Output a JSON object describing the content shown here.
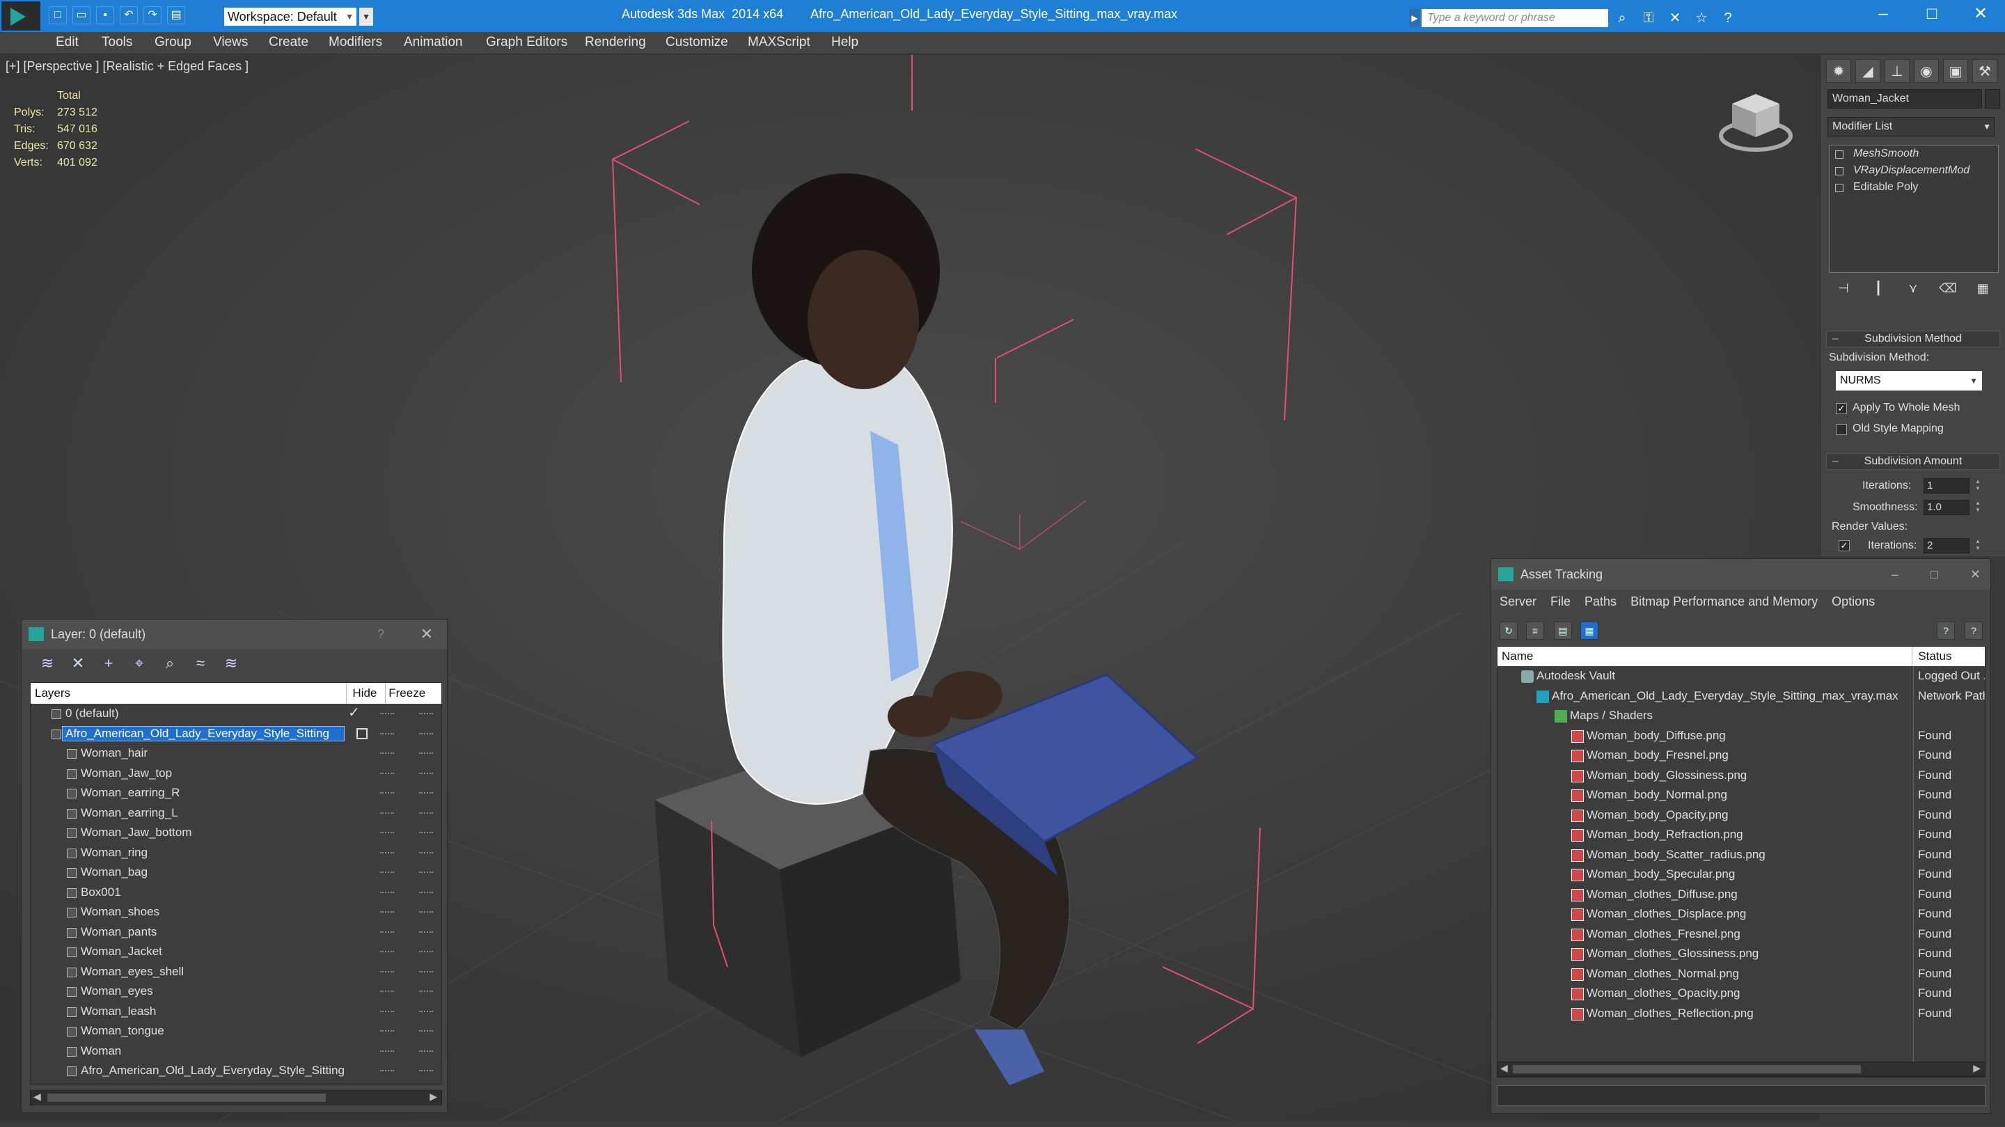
{
  "window": {
    "app_title": "Autodesk 3ds Max  2014 x64",
    "file_title": "Afro_American_Old_Lady_Everyday_Style_Sitting_max_vray.max",
    "workspace": "Workspace: Default",
    "search_placeholder": "Type a keyword or phrase"
  },
  "menu": [
    "Edit",
    "Tools",
    "Group",
    "Views",
    "Create",
    "Modifiers",
    "Animation",
    "Graph Editors",
    "Rendering",
    "Customize",
    "MAXScript",
    "Help"
  ],
  "viewport": {
    "label": "[+] [Perspective ] [Realistic + Edged Faces ]",
    "stats": {
      "header": "Total",
      "rows": [
        {
          "k": "Polys:",
          "v": "273 512"
        },
        {
          "k": "Tris:",
          "v": "547 016"
        },
        {
          "k": "Edges:",
          "v": "670 632"
        },
        {
          "k": "Verts:",
          "v": "401 092"
        }
      ]
    }
  },
  "layer_panel": {
    "title": "Layer: 0 (default)",
    "help": "?",
    "columns": {
      "layers": "Layers",
      "hide": "Hide",
      "freeze": "Freeze"
    },
    "rows": [
      "0 (default)",
      "Afro_American_Old_Lady_Everyday_Style_Sitting",
      "Woman_hair",
      "Woman_Jaw_top",
      "Woman_earring_R",
      "Woman_earring_L",
      "Woman_Jaw_bottom",
      "Woman_ring",
      "Woman_bag",
      "Box001",
      "Woman_shoes",
      "Woman_pants",
      "Woman_Jacket",
      "Woman_eyes_shell",
      "Woman_eyes",
      "Woman_leash",
      "Woman_tongue",
      "Woman",
      "Afro_American_Old_Lady_Everyday_Style_Sitting"
    ]
  },
  "command_panel": {
    "object_name": "Woman_Jacket",
    "modifier_list": "Modifier List",
    "stack": [
      "MeshSmooth",
      "VRayDisplacementMod",
      "Editable Poly"
    ],
    "subdiv_method_header": "Subdivision Method",
    "subdiv_method_label": "Subdivision Method:",
    "subdiv_method_value": "NURMS",
    "apply_whole_mesh": "Apply To Whole Mesh",
    "old_style_mapping": "Old Style Mapping",
    "subdiv_amount_header": "Subdivision Amount",
    "iterations_label": "Iterations:",
    "iterations_value": "1",
    "smoothness_label": "Smoothness:",
    "smoothness_value": "1.0",
    "render_values_label": "Render Values:",
    "render_iterations_label": "Iterations:",
    "render_iterations_value": "2"
  },
  "asset_tracking": {
    "title": "Asset Tracking",
    "menu": [
      "Server",
      "File",
      "Paths",
      "Bitmap Performance and Memory",
      "Options"
    ],
    "columns": {
      "name": "Name",
      "status": "Status"
    },
    "vault": {
      "name": "Autodesk Vault",
      "status": "Logged Out ."
    },
    "project": {
      "name": "Afro_American_Old_Lady_Everyday_Style_Sitting_max_vray.max",
      "status": "Network Path"
    },
    "maps": {
      "name": "Maps / Shaders"
    },
    "files": [
      {
        "name": "Woman_body_Diffuse.png",
        "status": "Found"
      },
      {
        "name": "Woman_body_Fresnel.png",
        "status": "Found"
      },
      {
        "name": "Woman_body_Glossiness.png",
        "status": "Found"
      },
      {
        "name": "Woman_body_Normal.png",
        "status": "Found"
      },
      {
        "name": "Woman_body_Opacity.png",
        "status": "Found"
      },
      {
        "name": "Woman_body_Refraction.png",
        "status": "Found"
      },
      {
        "name": "Woman_body_Scatter_radius.png",
        "status": "Found"
      },
      {
        "name": "Woman_body_Specular.png",
        "status": "Found"
      },
      {
        "name": "Woman_clothes_Diffuse.png",
        "status": "Found"
      },
      {
        "name": "Woman_clothes_Displace.png",
        "status": "Found"
      },
      {
        "name": "Woman_clothes_Fresnel.png",
        "status": "Found"
      },
      {
        "name": "Woman_clothes_Glossiness.png",
        "status": "Found"
      },
      {
        "name": "Woman_clothes_Normal.png",
        "status": "Found"
      },
      {
        "name": "Woman_clothes_Opacity.png",
        "status": "Found"
      },
      {
        "name": "Woman_clothes_Reflection.png",
        "status": "Found"
      }
    ]
  },
  "colors": {
    "titlebar": "#1e7fd4",
    "selection": "#1e6fcf",
    "stats": "#f0e6a0",
    "gizmo": "#e05070"
  }
}
